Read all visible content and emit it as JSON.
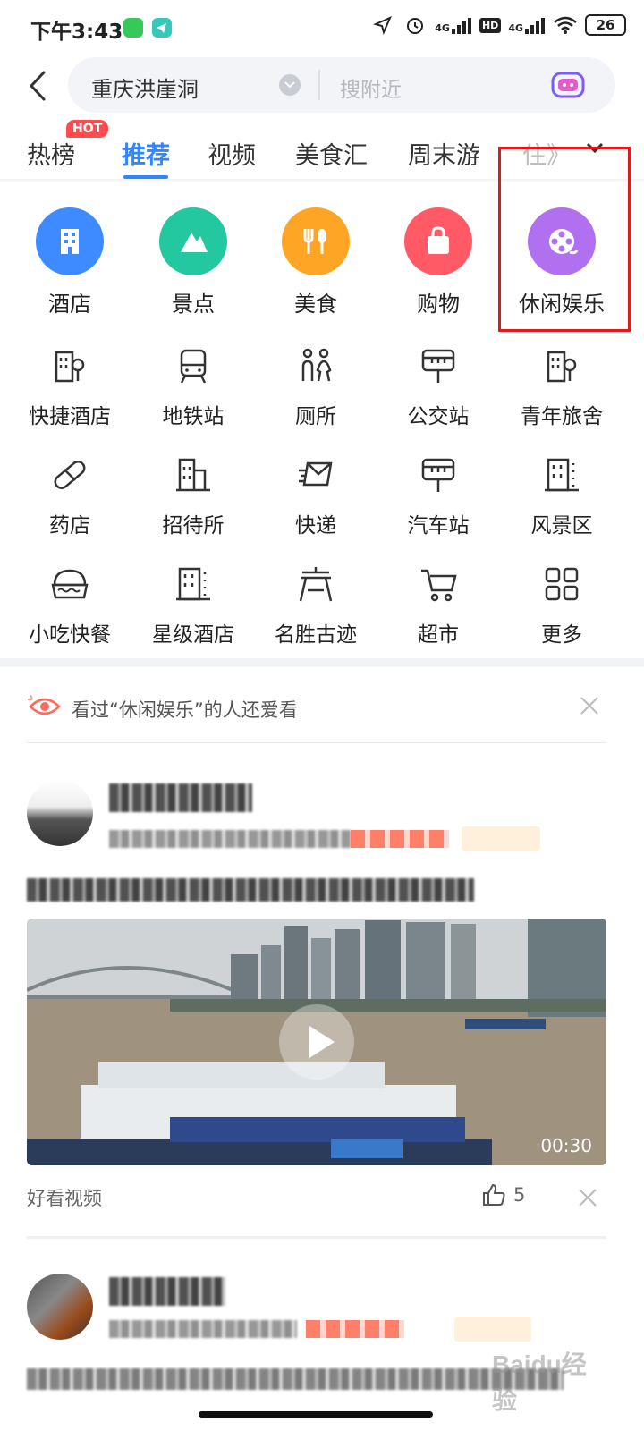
{
  "status_bar": {
    "time": "下午3:43",
    "net1": "4G",
    "hd": "HD",
    "net2": "4G",
    "battery": "26"
  },
  "search": {
    "city": "重庆洪崖洞",
    "placeholder": "搜附近"
  },
  "tabs": {
    "items": [
      {
        "label": "热榜"
      },
      {
        "label": "推荐"
      },
      {
        "label": "视频"
      },
      {
        "label": "美食汇"
      },
      {
        "label": "周末游"
      },
      {
        "label": "住》"
      }
    ],
    "hot_badge": "HOT",
    "active": "推荐"
  },
  "categories": [
    {
      "label": "酒店",
      "color": "#3d8bff",
      "icon": "hotel-icon"
    },
    {
      "label": "景点",
      "color": "#23c7a0",
      "icon": "mountain-icon"
    },
    {
      "label": "美食",
      "color": "#ffa526",
      "icon": "food-icon"
    },
    {
      "label": "购物",
      "color": "#ff5a66",
      "icon": "shopping-bag-icon"
    },
    {
      "label": "休闲娱乐",
      "color": "#b070f0",
      "icon": "film-reel-icon"
    }
  ],
  "grid": {
    "row1": [
      "快捷酒店",
      "地铁站",
      "厕所",
      "公交站",
      "青年旅舍"
    ],
    "row2": [
      "药店",
      "招待所",
      "快递",
      "汽车站",
      "风景区"
    ],
    "row3": [
      "小吃快餐",
      "星级酒店",
      "名胜古迹",
      "超市",
      "更多"
    ]
  },
  "recommend": {
    "text": "看过“休闲娱乐”的人还爱看"
  },
  "post1": {
    "video_duration": "00:30",
    "source": "好看视频",
    "likes": "5"
  },
  "watermark": "Baidu经验"
}
